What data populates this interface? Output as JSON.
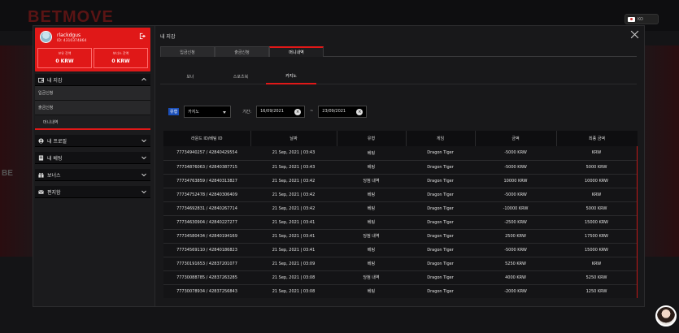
{
  "bg": {
    "logo": "BETMOVE",
    "side_text": "BE",
    "lang": "KO"
  },
  "profile": {
    "username": "rlackdgus",
    "id_line": "ID: 4310374864",
    "balances": [
      {
        "label": "보유 잔액",
        "value": "0 KRW"
      },
      {
        "label": "보너스 잔액",
        "value": "0 KRW"
      }
    ]
  },
  "menu": {
    "wallet": {
      "label": "내 지갑",
      "items": [
        "입금신청",
        "출금신청",
        "머니내역"
      ]
    },
    "profile": {
      "label": "내 프로필"
    },
    "bets": {
      "label": "내 베팅"
    },
    "bonus": {
      "label": "보너스"
    },
    "messages": {
      "label": "편지함"
    }
  },
  "panel": {
    "title": "내 지갑",
    "tabs": [
      "입금신청",
      "출금신청",
      "머니내역"
    ],
    "subtabs": [
      "보너",
      "스포츠북",
      "카지노"
    ],
    "filter": {
      "label": "유형",
      "select_value": "카지노",
      "period_label": "기간:",
      "from": "16/09/2021",
      "to": "23/09/2021",
      "separator": "~"
    },
    "table": {
      "headers": [
        "라운드 ID/베팅 ID",
        "날짜",
        "유형",
        "게임",
        "금액",
        "최종 금액"
      ],
      "rows": [
        [
          "77734940257 / 42840429554",
          "21 Sep, 2021 | 03:43",
          "베팅",
          "Dragon Tiger",
          "-5000 KRW",
          "KRW"
        ],
        [
          "77734876063 / 42840387715",
          "21 Sep, 2021 | 03:43",
          "베팅",
          "Dragon Tiger",
          "-5000 KRW",
          "5000 KRW"
        ],
        [
          "77734763859 / 42840313827",
          "21 Sep, 2021 | 03:42",
          "당첨 내역",
          "Dragon Tiger",
          "10000 KRW",
          "10000 KRW"
        ],
        [
          "77734752478 / 42840306409",
          "21 Sep, 2021 | 03:42",
          "베팅",
          "Dragon Tiger",
          "-5000 KRW",
          "KRW"
        ],
        [
          "77734692831 / 42840267714",
          "21 Sep, 2021 | 03:42",
          "베팅",
          "Dragon Tiger",
          "-10000 KRW",
          "5000 KRW"
        ],
        [
          "77734630904 / 42840227277",
          "21 Sep, 2021 | 03:41",
          "베팅",
          "Dragon Tiger",
          "-2500 KRW",
          "15000 KRW"
        ],
        [
          "77734580434 / 42840194169",
          "21 Sep, 2021 | 03:41",
          "당첨 내역",
          "Dragon Tiger",
          "2500 KRW",
          "17500 KRW"
        ],
        [
          "77734569110 / 42840186823",
          "21 Sep, 2021 | 03:41",
          "베팅",
          "Dragon Tiger",
          "-5000 KRW",
          "15000 KRW"
        ],
        [
          "77730191653 / 42837201077",
          "21 Sep, 2021 | 03:09",
          "베팅",
          "Dragon Tiger",
          "5250 KRW",
          "KRW"
        ],
        [
          "77730088785 / 42837263285",
          "21 Sep, 2021 | 03:08",
          "당첨 내역",
          "Dragon Tiger",
          "4000 KRW",
          "5250 KRW"
        ],
        [
          "77730078934 / 42837256843",
          "21 Sep, 2021 | 03:08",
          "베팅",
          "Dragon Tiger",
          "-2000 KRW",
          "1250 KRW"
        ]
      ]
    }
  },
  "colors": {
    "accent": "#e01818",
    "filter_label": "#1b4fb8"
  }
}
